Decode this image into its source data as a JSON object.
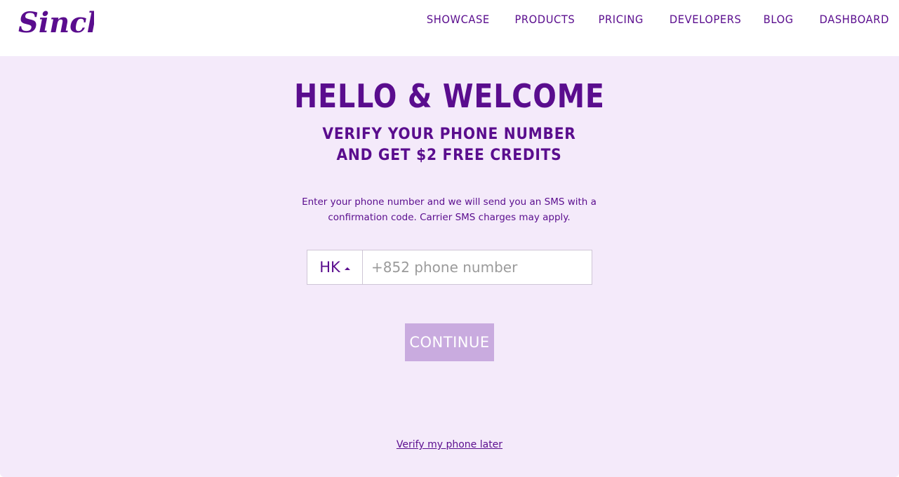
{
  "header": {
    "logo_text": "Sinch!",
    "nav": [
      "SHOWCASE",
      "PRODUCTS",
      "PRICING",
      "DEVELOPERS",
      "BLOG",
      "DASHBOARD"
    ]
  },
  "main": {
    "title": "HELLO & WELCOME",
    "subtitle": "VERIFY YOUR PHONE NUMBER AND GET $2 FREE CREDITS",
    "description": "Enter your phone number and we will send you an SMS with a confirmation code. Carrier SMS charges may apply.",
    "country_code": "HK",
    "phone_placeholder": "+852 phone number",
    "phone_value": "",
    "continue_label": "CONTINUE",
    "later_link": "Verify my phone later"
  },
  "colors": {
    "brand": "#5a0d8e",
    "background": "#f4eafa",
    "button_disabled": "#c9abdf"
  },
  "icons": [
    "sinch-logo",
    "caret-up-icon"
  ]
}
